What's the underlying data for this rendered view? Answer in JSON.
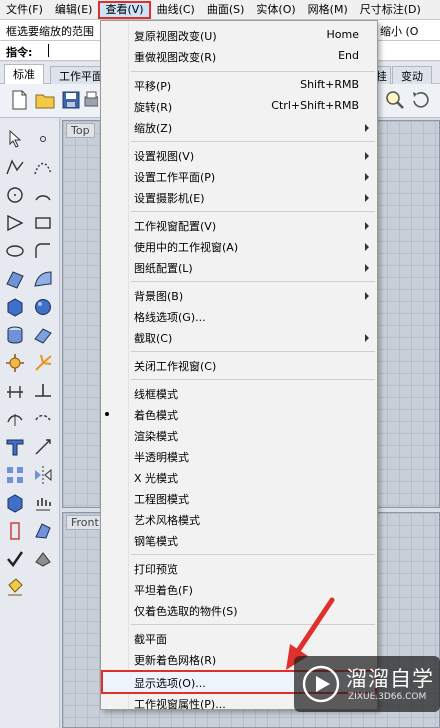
{
  "menubar": {
    "items": [
      {
        "label": "文件(F)"
      },
      {
        "label": "编辑(E)"
      },
      {
        "label": "查看(V)"
      },
      {
        "label": "曲线(C)"
      },
      {
        "label": "曲面(S)"
      },
      {
        "label": "实体(O)"
      },
      {
        "label": "网格(M)"
      },
      {
        "label": "尺寸标注(D)"
      }
    ]
  },
  "command": {
    "history": "框选要缩放的范围",
    "zoom_right": "缩小 (O",
    "prompt": "指令:"
  },
  "toolbar_tabs": {
    "tab1": "标准",
    "tab2": "工作平面",
    "tab3": "挂",
    "tab4": "变动"
  },
  "viewports": {
    "top": "Top",
    "front": "Front"
  },
  "view_menu": {
    "items": [
      {
        "label": "复原视图改变(U)",
        "shortcut": "Home"
      },
      {
        "label": "重做视图改变(R)",
        "shortcut": "End"
      },
      {
        "label": "平移(P)",
        "shortcut": "Shift+RMB"
      },
      {
        "label": "旋转(R)",
        "shortcut": "Ctrl+Shift+RMB"
      },
      {
        "label": "缩放(Z)"
      },
      {
        "label": "设置视图(V)"
      },
      {
        "label": "设置工作平面(P)"
      },
      {
        "label": "设置摄影机(E)"
      },
      {
        "label": "工作视窗配置(V)"
      },
      {
        "label": "使用中的工作视窗(A)"
      },
      {
        "label": "图纸配置(L)"
      },
      {
        "label": "背景图(B)"
      },
      {
        "label": "格线选项(G)..."
      },
      {
        "label": "截取(C)"
      },
      {
        "label": "关闭工作视窗(C)"
      },
      {
        "label": "线框模式"
      },
      {
        "label": "着色模式"
      },
      {
        "label": "渲染模式"
      },
      {
        "label": "半透明模式"
      },
      {
        "label": "X 光模式"
      },
      {
        "label": "工程图模式"
      },
      {
        "label": "艺术风格模式"
      },
      {
        "label": "钢笔模式"
      },
      {
        "label": "打印预览"
      },
      {
        "label": "平坦着色(F)"
      },
      {
        "label": "仅着色选取的物件(S)"
      },
      {
        "label": "截平面"
      },
      {
        "label": "更新着色网格(R)"
      },
      {
        "label": "显示选项(O)..."
      },
      {
        "label": "工作视窗属性(P)..."
      }
    ]
  },
  "colors": {
    "highlight_red": "#e0302c",
    "menu_bg": "#f2f2f2",
    "viewport_grid": "#c9cfd8"
  },
  "watermark": {
    "name": "溜溜自学",
    "url": "ZIXUE.3D66.COM"
  }
}
